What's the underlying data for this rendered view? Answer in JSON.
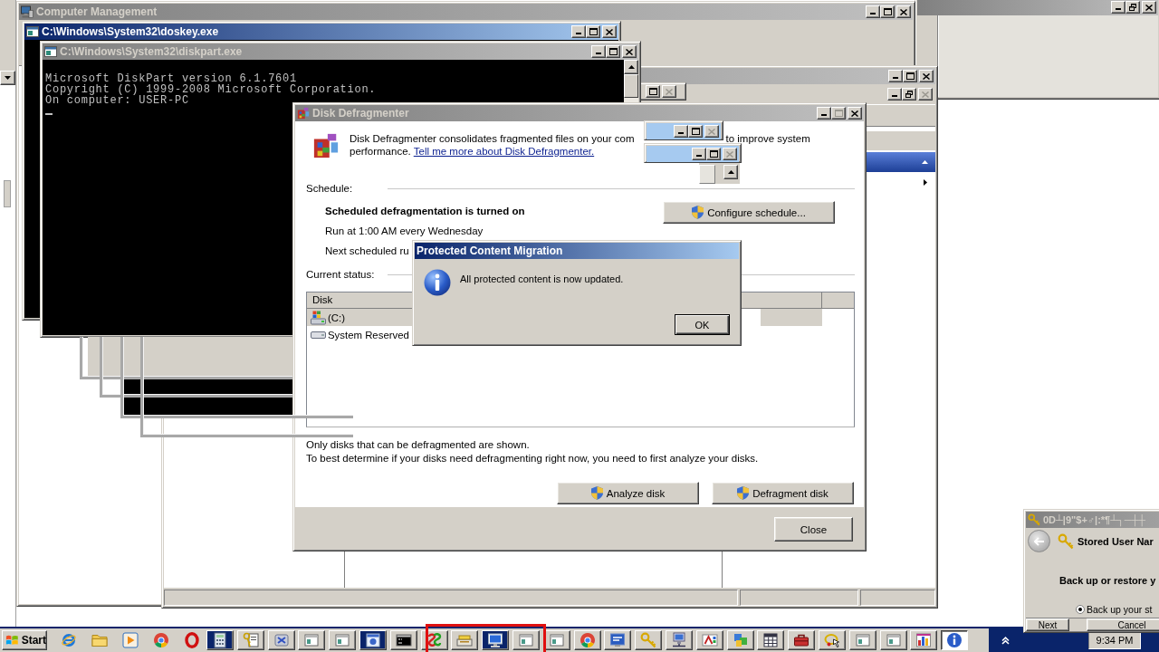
{
  "computer_management": {
    "title": "Computer Management",
    "active": false
  },
  "doskey_window": {
    "title": "C:\\Windows\\System32\\doskey.exe",
    "active": true
  },
  "diskpart_window": {
    "title": "C:\\Windows\\System32\\diskpart.exe",
    "active": false,
    "console_lines": [
      "Microsoft DiskPart version 6.1.7601",
      "Copyright (C) 1999-2008 Microsoft Corporation.",
      "On computer: USER-PC"
    ]
  },
  "disk_defragmenter": {
    "title": "Disk Defragmenter",
    "active": false,
    "can_maximize": false,
    "intro_start": "Disk Defragmenter consolidates fragmented files on your com",
    "intro_continued": "to improve system",
    "intro_end": "performance.",
    "help_link": "Tell me more about Disk Defragmenter.",
    "schedule": {
      "heading": "Schedule:",
      "status": "Scheduled defragmentation is turned on",
      "run_time": "Run at 1:00 AM every Wednesday",
      "next_run": "Next scheduled ru",
      "configure_button": "Configure schedule..."
    },
    "current_status": {
      "heading": "Current status:",
      "columns": [
        "Disk"
      ],
      "rows": [
        {
          "name": "(C:)",
          "kind": "system",
          "selected": true
        },
        {
          "name": "System Reserved",
          "kind": "plain",
          "selected": false
        }
      ]
    },
    "notes": [
      "Only disks that can be defragmented are shown.",
      "To best determine if your disks need defragmenting right now, you need to first analyze your disks."
    ],
    "buttons": [
      "Analyze disk",
      "Defragment disk"
    ],
    "close_button": "Close"
  },
  "message_dialog": {
    "title": "Protected Content Migration",
    "active": true,
    "message": "All protected content is now updated.",
    "ok_button": "OK"
  },
  "stored_user_names": {
    "title": "0D┴|9\"$+♂|:*¶┴┐─┼┼",
    "active": false,
    "heading": "Stored User Nar",
    "subheading": "Back up or restore y",
    "options": [
      {
        "label": "Back up your st",
        "selected": true
      }
    ],
    "buttons": [
      "Next",
      "Cancel"
    ]
  },
  "taskbar": {
    "start_button": "Start",
    "tasks": [
      {
        "flashing": true,
        "selected": false
      },
      {
        "flashing": false,
        "selected": false
      },
      {
        "flashing": false,
        "selected": false
      },
      {
        "flashing": false,
        "selected": false
      },
      {
        "flashing": false,
        "selected": false
      },
      {
        "flashing": true,
        "selected": false
      },
      {
        "flashing": false,
        "selected": false
      },
      {
        "flashing": false,
        "selected": false
      },
      {
        "flashing": false,
        "selected": false
      },
      {
        "flashing": true,
        "selected": false
      },
      {
        "flashing": false,
        "selected": false
      },
      {
        "flashing": false,
        "selected": false
      },
      {
        "flashing": false,
        "selected": false
      },
      {
        "flashing": false,
        "selected": false
      },
      {
        "flashing": false,
        "selected": false
      },
      {
        "flashing": false,
        "selected": false
      },
      {
        "flashing": false,
        "selected": false
      },
      {
        "flashing": false,
        "selected": false
      },
      {
        "flashing": false,
        "selected": false
      },
      {
        "flashing": false,
        "selected": false
      },
      {
        "flashing": false,
        "selected": false
      },
      {
        "flashing": false,
        "selected": false
      },
      {
        "flashing": false,
        "selected": false
      },
      {
        "flashing": false,
        "selected": false
      },
      {
        "flashing": false,
        "selected": true
      }
    ],
    "clock": "9:34 PM"
  }
}
